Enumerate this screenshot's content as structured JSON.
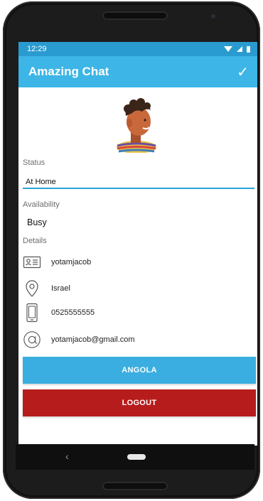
{
  "statusbar": {
    "time": "12:29"
  },
  "appbar": {
    "title": "Amazing Chat",
    "confirm_glyph": "✓"
  },
  "profile": {
    "status_label": "Status",
    "status_value": "At Home",
    "availability_label": "Availability",
    "availability_value": "Busy",
    "details_label": "Details",
    "details": [
      {
        "icon": "contact-card-icon",
        "value": "yotamjacob"
      },
      {
        "icon": "location-pin-icon",
        "value": "Israel"
      },
      {
        "icon": "phone-icon",
        "value": "0525555555"
      },
      {
        "icon": "at-sign-icon",
        "value": "yotamjacob@gmail.com"
      }
    ]
  },
  "buttons": {
    "angola": "ANGOLA",
    "logout": "LOGOUT"
  },
  "nav": {
    "back_glyph": "‹"
  },
  "colors": {
    "appbar": "#3db5e6",
    "statusbar": "#2a9bd0",
    "accent": "#3aaee0",
    "danger": "#b71c1c"
  }
}
